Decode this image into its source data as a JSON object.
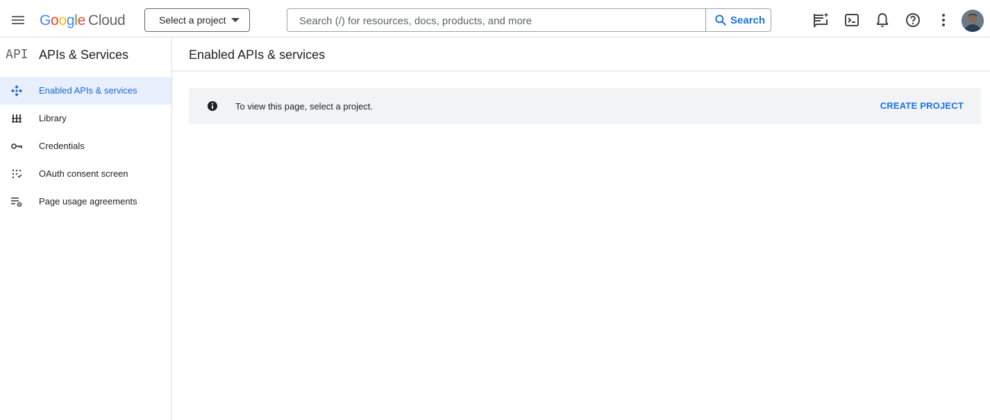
{
  "header": {
    "logo_google": [
      "G",
      "o",
      "o",
      "g",
      "l",
      "e"
    ],
    "logo_cloud": "Cloud",
    "project_picker_label": "Select a project",
    "search_placeholder": "Search (/) for resources, docs, products, and more",
    "search_button_label": "Search",
    "icons": [
      "menu-icon",
      "gemini-chat-icon",
      "cloud-shell-icon",
      "notifications-icon",
      "help-icon",
      "more-vert-icon",
      "avatar"
    ]
  },
  "sidebar": {
    "product_logo": "API",
    "title": "APIs & Services",
    "items": [
      {
        "label": "Enabled APIs & services",
        "icon": "enabled-apis-icon",
        "active": true
      },
      {
        "label": "Library",
        "icon": "library-icon",
        "active": false
      },
      {
        "label": "Credentials",
        "icon": "key-icon",
        "active": false
      },
      {
        "label": "OAuth consent screen",
        "icon": "oauth-consent-icon",
        "active": false
      },
      {
        "label": "Page usage agreements",
        "icon": "settings-list-icon",
        "active": false
      }
    ]
  },
  "main": {
    "title": "Enabled APIs & services",
    "banner": {
      "text": "To view this page, select a project.",
      "action": "CREATE PROJECT"
    }
  },
  "colors": {
    "accent": "#1a73e8",
    "active_bg": "#e8f0fe",
    "banner_bg": "#f1f3f4",
    "divider": "#dadce0"
  }
}
